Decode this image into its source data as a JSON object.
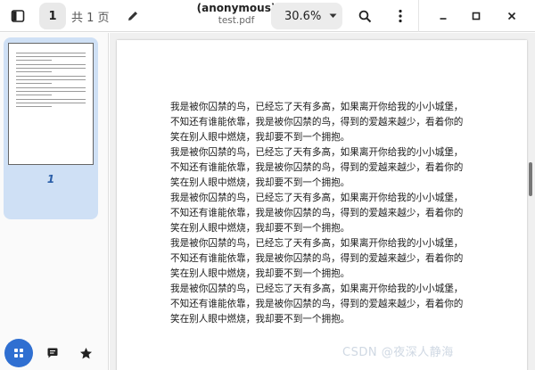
{
  "header": {
    "page_number": "1",
    "page_total_label": "共 1 页",
    "document_title": "(anonymous)",
    "document_filename": "test.pdf",
    "zoom_level": "30.6%"
  },
  "sidebar": {
    "thumbnail_page_label": "1"
  },
  "document": {
    "lines": [
      "我是被你囚禁的鸟，已经忘了天有多高，如果离开你给我的小小城堡，",
      "不知还有谁能依靠，我是被你囚禁的鸟，得到的爱越来越少，看着你的",
      "笑在别人眼中燃烧，我却要不到一个拥抱。",
      "我是被你囚禁的鸟，已经忘了天有多高，如果离开你给我的小小城堡，",
      "不知还有谁能依靠，我是被你囚禁的鸟，得到的爱越来越少，看着你的",
      "笑在别人眼中燃烧，我却要不到一个拥抱。",
      "我是被你囚禁的鸟，已经忘了天有多高，如果离开你给我的小小城堡，",
      "不知还有谁能依靠，我是被你囚禁的鸟，得到的爱越来越少，看着你的",
      "笑在别人眼中燃烧，我却要不到一个拥抱。",
      "我是被你囚禁的鸟，已经忘了天有多高，如果离开你给我的小小城堡，",
      "不知还有谁能依靠，我是被你囚禁的鸟，得到的爱越来越少，看着你的",
      "笑在别人眼中燃烧，我却要不到一个拥抱。",
      "我是被你囚禁的鸟，已经忘了天有多高，如果离开你给我的小小城堡，",
      "不知还有谁能依靠，我是被你囚禁的鸟，得到的爱越来越少，看着你的",
      "笑在别人眼中燃烧，我却要不到一个拥抱。"
    ]
  },
  "watermark": {
    "text": "CSDN @夜深人静海"
  },
  "icons": {
    "sidebar_toggle": "sidebar-toggle-icon",
    "annotate": "pencil-icon",
    "zoom_dropdown": "caret-down-icon",
    "search": "search-icon",
    "menu": "kebab-menu-icon",
    "minimize": "minimize-icon",
    "maximize": "maximize-icon",
    "close": "close-icon",
    "thumbnails": "grid-icon",
    "annotations": "comment-icon",
    "bookmarks": "star-icon"
  },
  "colors": {
    "accent": "#2f6fd1",
    "selected_thumbnail_bg": "#cfe0f5"
  }
}
